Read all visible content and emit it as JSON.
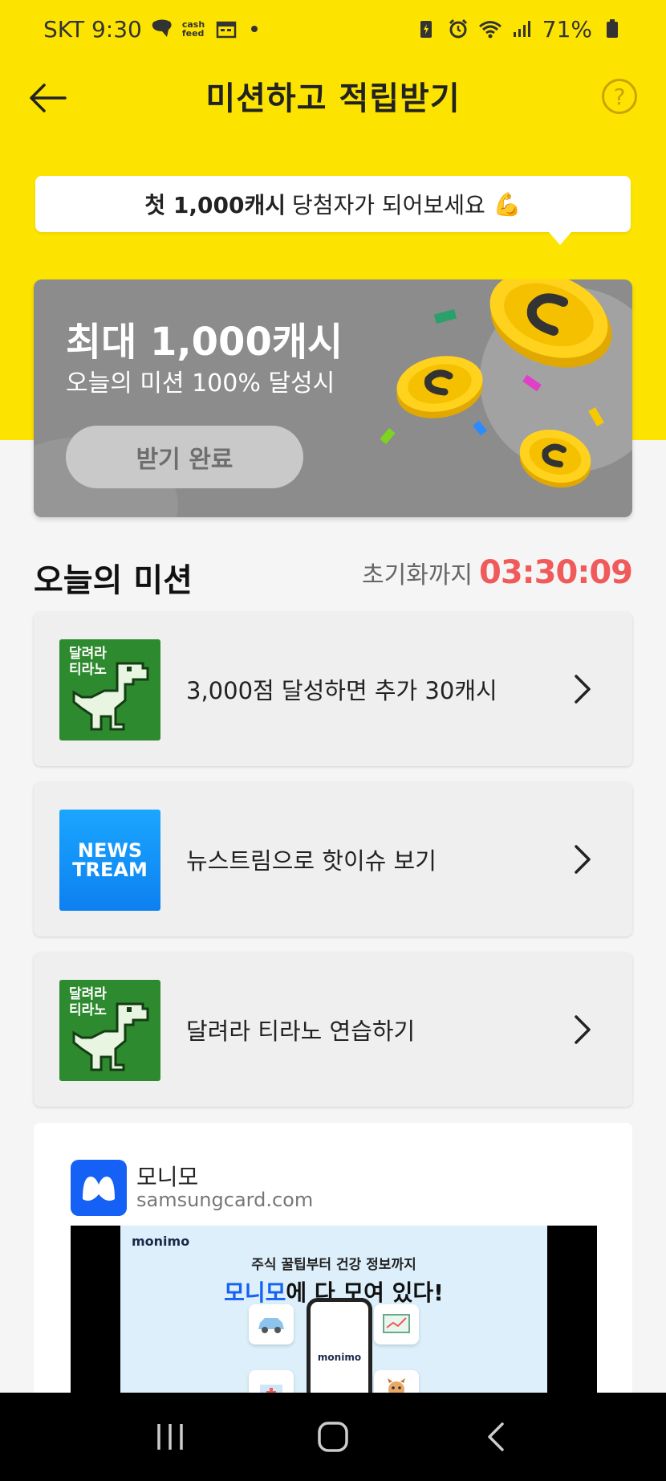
{
  "status": {
    "carrier_time": "SKT 9:30",
    "cashfeed_label": "cash feed",
    "battery": "71%"
  },
  "header": {
    "title": "미션하고 적립받기",
    "help_label": "?"
  },
  "bubble": {
    "bold": "첫 1,000캐시",
    "rest": "당첨자가 되어보세요",
    "emoji": "💪"
  },
  "reward": {
    "title": "최대 1,000캐시",
    "subtitle": "오늘의 미션 100% 달성시",
    "button": "받기 완료"
  },
  "missions_section": {
    "title": "오늘의 미션",
    "reset_label": "초기화까지",
    "reset_time": "03:30:09"
  },
  "missions": [
    {
      "thumb_text": "달려라\n티라노",
      "label": "3,000점 달성하면 추가 30캐시"
    },
    {
      "thumb_text": "NEWS\nTREAM",
      "label": "뉴스트림으로 핫이슈 보기"
    },
    {
      "thumb_text": "달려라\n티라노",
      "label": "달려라 티라노 연습하기"
    }
  ],
  "ad": {
    "name": "모니모",
    "domain": "samsungcard.com",
    "brand": "monimo",
    "line1": "주식 꿀팁부터 건강 정보까지",
    "line2_blue": "모니모",
    "line2_rest": "에 다 모여 있다!",
    "phone_label": "monimo"
  },
  "colors": {
    "accent_yellow": "#fde400",
    "timer_red": "#f05a5a",
    "card_gray": "#8c8c8c",
    "dino_green": "#2e8a2e",
    "news_blue": "#0d80f0",
    "monimo_blue": "#1560f5"
  }
}
